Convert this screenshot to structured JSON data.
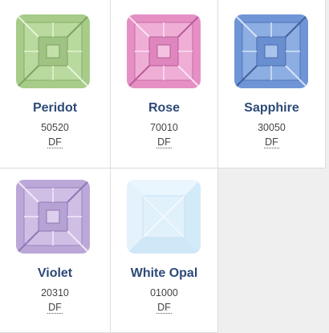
{
  "products": [
    {
      "name": "Peridot",
      "code": "50520",
      "finish": "DF",
      "color": "#a7cc8a",
      "icon": "peridot-gem-icon"
    },
    {
      "name": "Rose",
      "code": "70010",
      "finish": "DF",
      "color": "#e58fc4",
      "icon": "rose-gem-icon"
    },
    {
      "name": "Sapphire",
      "code": "30050",
      "finish": "DF",
      "color": "#6f95d6",
      "icon": "sapphire-gem-icon"
    },
    {
      "name": "Violet",
      "code": "20310",
      "finish": "DF",
      "color": "#bca8d8",
      "icon": "violet-gem-icon"
    },
    {
      "name": "White Opal",
      "code": "01000",
      "finish": "DF",
      "color": "#dbeefa",
      "icon": "white-opal-gem-icon"
    }
  ]
}
